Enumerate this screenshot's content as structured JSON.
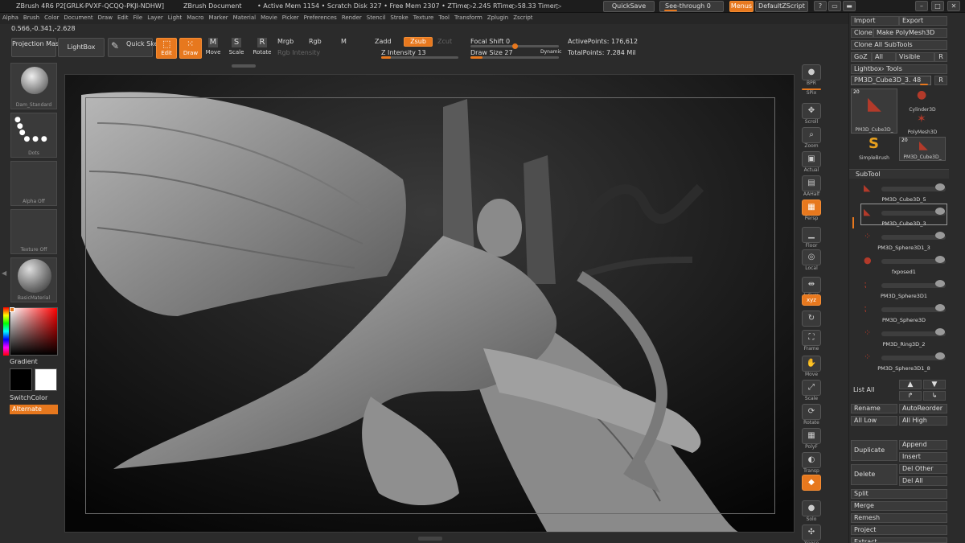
{
  "titlebar": {
    "app": "ZBrush 4R6 P2[GRLK-PVXF-QCQQ-PKJI-NDHW]",
    "document": "ZBrush Document",
    "stats": "• Active Mem 1154 • Scratch Disk 327 • Free Mem 2307 • ZTime▷2.245 RTime▷58.33 Timer▷",
    "quicksave": "QuickSave",
    "see_through": "See-through 0",
    "menus": "Menus",
    "script": "DefaultZScript",
    "win_buttons": [
      "?",
      "▭",
      "▬",
      "–",
      "□",
      "✕"
    ]
  },
  "menu_items": [
    "Alpha",
    "Brush",
    "Color",
    "Document",
    "Draw",
    "Edit",
    "File",
    "Layer",
    "Light",
    "Macro",
    "Marker",
    "Material",
    "Movie",
    "Picker",
    "Preferences",
    "Render",
    "Stencil",
    "Stroke",
    "Texture",
    "Tool",
    "Transform",
    "Zplugin",
    "Zscript"
  ],
  "coords": "0.566,-0.341,-2.628",
  "toolbar": {
    "projection_master": "Projection Master",
    "lightbox": "LightBox",
    "quick_sketch": "Quick Sketch",
    "edit": "Edit",
    "draw": "Draw",
    "move": "Move",
    "scale": "Scale",
    "rotate": "Rotate",
    "mrgb": "Mrgb",
    "rgb": "Rgb",
    "m": "M",
    "rgb_intensity": "Rgb Intensity",
    "zadd": "Zadd",
    "zsub": "Zsub",
    "zcut": "Zcut",
    "z_intensity": "Z Intensity 13",
    "focal_shift": "Focal Shift 0",
    "draw_size": "Draw Size 27",
    "dynamic": "Dynamic",
    "active_points": "ActivePoints: 176,612",
    "total_points": "TotalPoints: 7.284 Mil",
    "z_intensity_level": 0.13,
    "focal_shift_level": 0.5,
    "draw_size_level": 0.14
  },
  "left_shelf": {
    "brush": "Dam_Standard",
    "stroke": "Dots",
    "alpha": "Alpha Off",
    "texture": "Texture Off",
    "material": "BasicMaterial",
    "gradient": "Gradient",
    "switch_color": "SwitchColor",
    "alternate": "Alternate"
  },
  "right_shelf": [
    {
      "icon": "bpr-icon",
      "glyph": "●",
      "label": "BPR",
      "active": false
    },
    {
      "icon": "spix-icon",
      "glyph": "",
      "label": "SPix",
      "active": false
    },
    {
      "icon": "scroll-icon",
      "glyph": "✥",
      "label": "Scroll",
      "active": false
    },
    {
      "icon": "zoom-icon",
      "glyph": "⌕",
      "label": "Zoom",
      "active": false
    },
    {
      "icon": "actual-icon",
      "glyph": "▣",
      "label": "Actual",
      "active": false
    },
    {
      "icon": "aahalf-icon",
      "glyph": "▤",
      "label": "AAHalf",
      "active": false
    },
    {
      "icon": "persp-icon",
      "glyph": "▦",
      "label": "Persp",
      "active": true
    },
    {
      "icon": "floor-icon",
      "glyph": "▁",
      "label": "Floor",
      "active": false
    },
    {
      "icon": "local-icon",
      "glyph": "◎",
      "label": "Local",
      "active": false
    },
    {
      "icon": "lsym-icon",
      "glyph": "⇹",
      "label": "L.Sym",
      "active": false
    },
    {
      "icon": "xyz-icon",
      "glyph": "xyz",
      "label": "",
      "active": true
    },
    {
      "icon": "rotate-axis-icon",
      "glyph": "↻",
      "label": "",
      "active": false
    },
    {
      "icon": "frame-icon",
      "glyph": "⛶",
      "label": "Frame",
      "active": false
    },
    {
      "icon": "move-icon",
      "glyph": "✋",
      "label": "Move",
      "active": false
    },
    {
      "icon": "scale-icon",
      "glyph": "⤢",
      "label": "Scale",
      "active": false
    },
    {
      "icon": "rotate-icon",
      "glyph": "⟳",
      "label": "Rotate",
      "active": false
    },
    {
      "icon": "polyf-icon",
      "glyph": "▦",
      "label": "PolyF",
      "active": false
    },
    {
      "icon": "transp-icon",
      "glyph": "◐",
      "label": "Transp",
      "active": false
    },
    {
      "icon": "ghost-icon",
      "glyph": "◆",
      "label": "",
      "active": true
    },
    {
      "icon": "solo-icon",
      "glyph": "●",
      "label": "Solo",
      "active": false
    },
    {
      "icon": "xpose-icon",
      "glyph": "✣",
      "label": "Xpose",
      "active": false
    }
  ],
  "tool_panel": {
    "import": "Import",
    "export": "Export",
    "clone": "Clone",
    "make_polymesh": "Make PolyMesh3D",
    "clone_all": "Clone All SubTools",
    "goz": "GoZ",
    "all": "All",
    "visible": "Visible",
    "r": "R",
    "lightbox_tools": "Lightbox› Tools",
    "current_tool": "PM3D_Cube3D_3. 48",
    "tools": [
      {
        "name": "PM3D_Cube3D_",
        "count": "20"
      },
      {
        "name": "Cylinder3D",
        "count": ""
      },
      {
        "name": "PolyMesh3D",
        "count": ""
      },
      {
        "name": "SimpleBrush",
        "count": ""
      },
      {
        "name": "PM3D_Cube3D_",
        "count": "20"
      }
    ],
    "subtool_header": "SubTool",
    "subtools": [
      {
        "name": "PM3D_Cube3D_5",
        "selected": false
      },
      {
        "name": "PM3D_Cube3D_3",
        "selected": true
      },
      {
        "name": "PM3D_Sphere3D1_3",
        "selected": false
      },
      {
        "name": "fxposed1",
        "selected": false
      },
      {
        "name": "PM3D_Sphere3D1",
        "selected": false
      },
      {
        "name": "PM3D_Sphere3D",
        "selected": false
      },
      {
        "name": "PM3D_Ring3D_2",
        "selected": false
      },
      {
        "name": "PM3D_Sphere3D1_8",
        "selected": false
      }
    ],
    "list_all": "List All",
    "rename": "Rename",
    "auto_reorder": "AutoReorder",
    "all_low": "All Low",
    "all_high": "All High",
    "duplicate": "Duplicate",
    "append": "Append",
    "insert": "Insert",
    "delete": "Delete",
    "del_other": "Del Other",
    "del_all": "Del All",
    "split": "Split",
    "merge": "Merge",
    "remesh": "Remesh",
    "project": "Project",
    "extract": "Extract"
  },
  "colors": {
    "accent": "#e7781e",
    "panel": "#2b2b2b",
    "button": "#3a3a3a"
  }
}
